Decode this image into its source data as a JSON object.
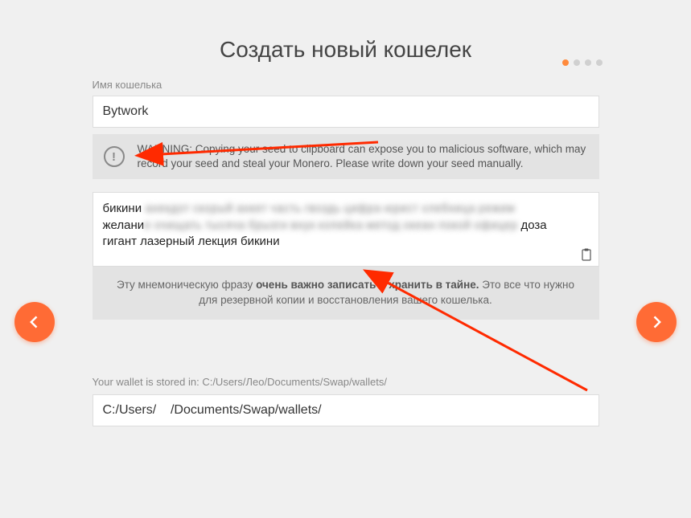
{
  "title": "Создать новый кошелек",
  "wallet_name": {
    "label": "Имя кошелька",
    "value": "Bytwork"
  },
  "warning": {
    "text": "WARNING: Copying your seed to clipboard can expose you to malicious software, which may record your seed and steal your Monero. Please write down your seed manually."
  },
  "seed": {
    "line1_visible": "бикини",
    "line1_blur": " анекдот скорый анкет часть гвоздь цифра юрист хлебница режим",
    "line2_visible_a": "желани",
    "line2_blur": "е очищать тысяча брызги внук копейка метод океан покой офицер",
    "line2_visible_b": " доза",
    "line3_visible": "гигант лазерный лекция бикини"
  },
  "mnemonic_note": {
    "pre": "Эту мнемоническую фразу ",
    "bold": "очень важно записать и хранить в тайне.",
    "post": " Это все что нужно для резервной копии и восстановления вашего кошелька."
  },
  "path": {
    "label_prefix": "Your wallet is stored in: ",
    "label_path": "C:/Users/Лео/Documents/Swap/wallets/",
    "value": "C:/Users/    /Documents/Swap/wallets/"
  },
  "colors": {
    "accent": "#ff6b35"
  }
}
